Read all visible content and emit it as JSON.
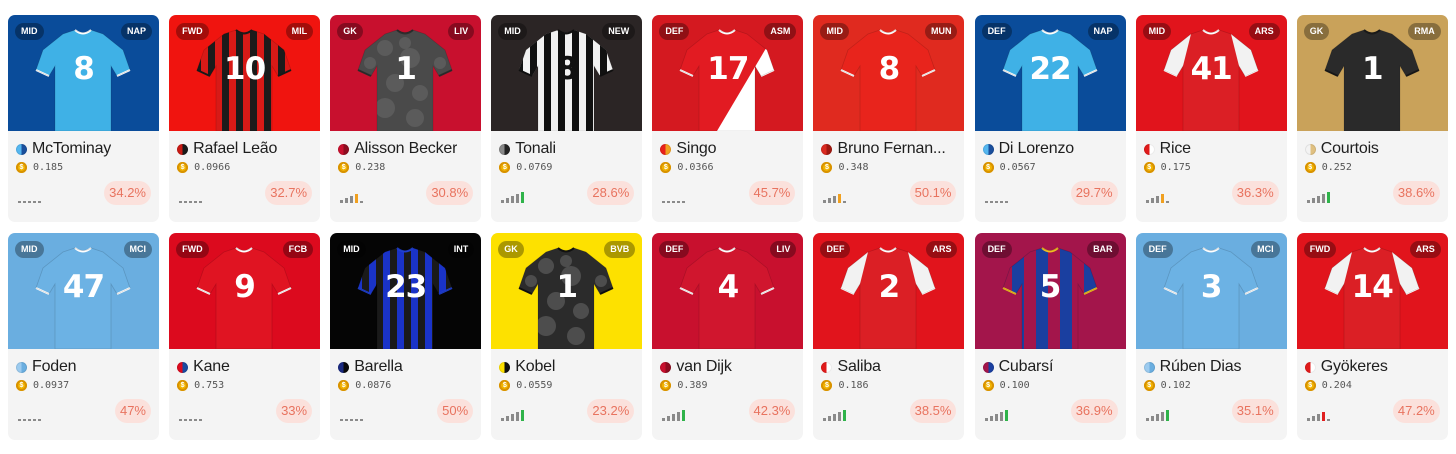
{
  "cards": [
    {
      "position": "MID",
      "club": "NAP",
      "number": "8",
      "name": "McTominay",
      "price": "0.185",
      "percent": "34.2%",
      "bg": "#0a4c9a",
      "shirt": "#3fb1e6",
      "trim": "#ffffff",
      "numColor": "#ffffff",
      "pattern": "plain",
      "flag": [
        "#55b7f0",
        "#1a4f9c"
      ],
      "bars": 0,
      "barColor": "#9a9a9a"
    },
    {
      "position": "FWD",
      "club": "MIL",
      "number": "10",
      "name": "Rafael Leão",
      "price": "0.0966",
      "percent": "32.7%",
      "bg": "#f0140f",
      "shirt": "#d81a17",
      "trim": "#1b1b1b",
      "numColor": "#ffffff",
      "pattern": "stripes-black",
      "flag": [
        "#c81a14",
        "#1a1a1a"
      ],
      "bars": 0,
      "barColor": "#9a9a9a"
    },
    {
      "position": "GK",
      "club": "LIV",
      "number": "1",
      "name": "Alisson Becker",
      "price": "0.238",
      "percent": "30.8%",
      "bg": "#c8102e",
      "shirt": "#4a4a4a",
      "trim": "#2e2e2e",
      "numColor": "#ffffff",
      "pattern": "camo",
      "flag": [
        "#c8102e",
        "#8e0c20"
      ],
      "bars": 4,
      "barColor": "#f0a020"
    },
    {
      "position": "MID",
      "club": "NEW",
      "number": "8",
      "name": "Tonali",
      "price": "0.0769",
      "percent": "28.6%",
      "bg": "#2b2525",
      "shirt": "#f2f2f2",
      "trim": "#111111",
      "numColor": "#111111",
      "pattern": "stripes-bw",
      "flag": [
        "#888888",
        "#222222"
      ],
      "bars": 5,
      "barColor": "#2fb34a"
    },
    {
      "position": "DEF",
      "club": "ASM",
      "number": "17",
      "name": "Singo",
      "price": "0.0366",
      "percent": "45.7%",
      "bg": "#d41920",
      "shirt": "#e21b22",
      "trim": "#ffffff",
      "numColor": "#ffffff",
      "pattern": "diagonal",
      "flag": [
        "#e8201a",
        "#f0a020"
      ],
      "bars": 0,
      "barColor": "#9a9a9a"
    },
    {
      "position": "MID",
      "club": "MUN",
      "number": "8",
      "name": "Bruno Fernan...",
      "price": "0.348",
      "percent": "50.1%",
      "bg": "#e02a1f",
      "shirt": "#e8241c",
      "trim": "#ffffff",
      "numColor": "#ffffff",
      "pattern": "plain",
      "flag": [
        "#da2a20",
        "#a01810"
      ],
      "bars": 4,
      "barColor": "#f0a020"
    },
    {
      "position": "DEF",
      "club": "NAP",
      "number": "22",
      "name": "Di Lorenzo",
      "price": "0.0567",
      "percent": "29.7%",
      "bg": "#0a4c9a",
      "shirt": "#3fb1e6",
      "trim": "#ffffff",
      "numColor": "#ffffff",
      "pattern": "plain",
      "flag": [
        "#55b7f0",
        "#1a4f9c"
      ],
      "bars": 0,
      "barColor": "#9a9a9a"
    },
    {
      "position": "MID",
      "club": "ARS",
      "number": "41",
      "name": "Rice",
      "price": "0.175",
      "percent": "36.3%",
      "bg": "#e1141c",
      "shirt": "#db1f25",
      "trim": "#ffffff",
      "numColor": "#ffffff",
      "pattern": "sleeves-white",
      "flag": [
        "#e01a1a",
        "#ffffff"
      ],
      "bars": 4,
      "barColor": "#f0a020"
    },
    {
      "position": "GK",
      "club": "RMA",
      "number": "1",
      "name": "Courtois",
      "price": "0.252",
      "percent": "38.6%",
      "bg": "#c9a25a",
      "shirt": "#2a2a2a",
      "trim": "#1a1a1a",
      "numColor": "#ffffff",
      "pattern": "plain",
      "flag": [
        "#f3f3f3",
        "#e0c080"
      ],
      "bars": 5,
      "barColor": "#2fb34a"
    },
    {
      "position": "MID",
      "club": "MCI",
      "number": "47",
      "name": "Foden",
      "price": "0.0937",
      "percent": "47%",
      "bg": "#6aaee0",
      "shirt": "#6cb2e4",
      "trim": "#ffffff",
      "numColor": "#ffffff",
      "pattern": "plain",
      "flag": [
        "#9ccbef",
        "#6aaee0"
      ],
      "bars": 0,
      "barColor": "#9a9a9a"
    },
    {
      "position": "FWD",
      "club": "FCB",
      "number": "9",
      "name": "Kane",
      "price": "0.753",
      "percent": "33%",
      "bg": "#dc0a1e",
      "shirt": "#e01422",
      "trim": "#ffffff",
      "numColor": "#ffffff",
      "pattern": "plain",
      "flag": [
        "#dc0a1e",
        "#1a4aa0"
      ],
      "bars": 0,
      "barColor": "#9a9a9a"
    },
    {
      "position": "MID",
      "club": "INT",
      "number": "23",
      "name": "Barella",
      "price": "0.0876",
      "percent": "50%",
      "bg": "#050505",
      "shirt": "#1a1a1a",
      "trim": "#2040d0",
      "numColor": "#ffffff",
      "pattern": "stripes-blue",
      "flag": [
        "#1a2a80",
        "#0a0a0a"
      ],
      "bars": 0,
      "barColor": "#9a9a9a"
    },
    {
      "position": "GK",
      "club": "BVB",
      "number": "1",
      "name": "Kobel",
      "price": "0.0559",
      "percent": "23.2%",
      "bg": "#fde100",
      "shirt": "#2b2b2b",
      "trim": "#111111",
      "numColor": "#ffffff",
      "pattern": "camo",
      "flag": [
        "#fde100",
        "#111111"
      ],
      "bars": 5,
      "barColor": "#2fb34a"
    },
    {
      "position": "DEF",
      "club": "LIV",
      "number": "4",
      "name": "van Dijk",
      "price": "0.389",
      "percent": "42.3%",
      "bg": "#c8102e",
      "shirt": "#d0162e",
      "trim": "#ffffff",
      "numColor": "#ffffff",
      "pattern": "plain",
      "flag": [
        "#c8102e",
        "#8e0c20"
      ],
      "bars": 5,
      "barColor": "#2fb34a"
    },
    {
      "position": "DEF",
      "club": "ARS",
      "number": "2",
      "name": "Saliba",
      "price": "0.186",
      "percent": "38.5%",
      "bg": "#e1141c",
      "shirt": "#db1f25",
      "trim": "#ffffff",
      "numColor": "#ffffff",
      "pattern": "sleeves-white",
      "flag": [
        "#e01a1a",
        "#ffffff"
      ],
      "bars": 5,
      "barColor": "#2fb34a"
    },
    {
      "position": "DEF",
      "club": "BAR",
      "number": "5",
      "name": "Cubarsí",
      "price": "0.100",
      "percent": "36.9%",
      "bg": "#a3154b",
      "shirt": "#1a3fa0",
      "trim": "#f0c020",
      "numColor": "#ffffff",
      "pattern": "stripes-barca",
      "flag": [
        "#a3154b",
        "#1a3fa0"
      ],
      "bars": 5,
      "barColor": "#2fb34a"
    },
    {
      "position": "DEF",
      "club": "MCI",
      "number": "3",
      "name": "Rúben Dias",
      "price": "0.102",
      "percent": "35.1%",
      "bg": "#6aaee0",
      "shirt": "#6cb2e4",
      "trim": "#ffffff",
      "numColor": "#ffffff",
      "pattern": "plain",
      "flag": [
        "#9ccbef",
        "#6aaee0"
      ],
      "bars": 5,
      "barColor": "#2fb34a"
    },
    {
      "position": "FWD",
      "club": "ARS",
      "number": "14",
      "name": "Gyökeres",
      "price": "0.204",
      "percent": "47.2%",
      "bg": "#e1141c",
      "shirt": "#db1f25",
      "trim": "#ffffff",
      "numColor": "#ffffff",
      "pattern": "sleeves-white",
      "flag": [
        "#e01a1a",
        "#ffffff"
      ],
      "bars": 4,
      "barColor": "#e02020"
    }
  ]
}
